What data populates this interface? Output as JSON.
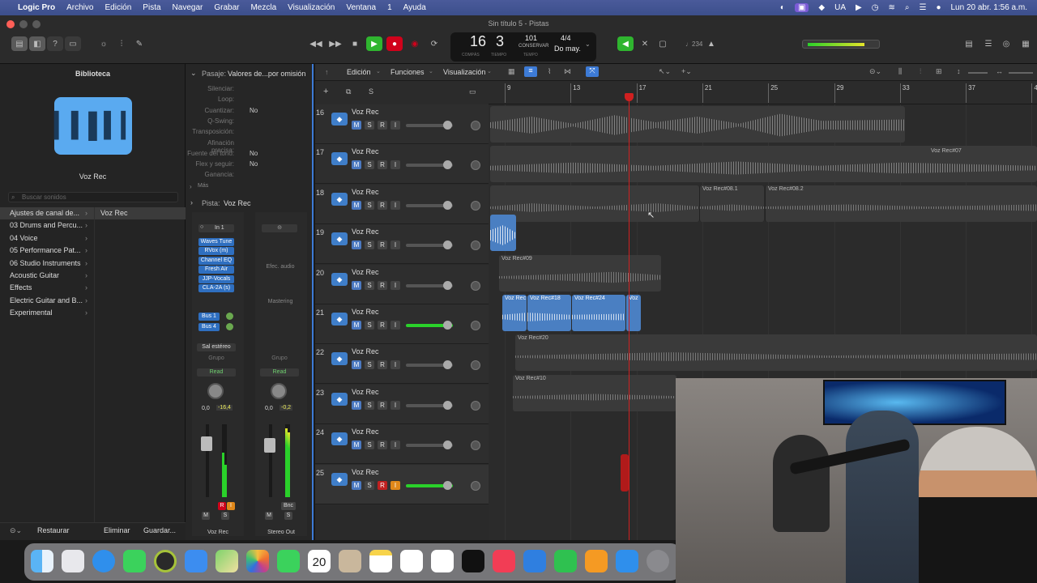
{
  "menubar": {
    "app": "Logic Pro",
    "items": [
      "Archivo",
      "Edición",
      "Pista",
      "Navegar",
      "Grabar",
      "Mezcla",
      "Visualización",
      "Ventana",
      "1",
      "Ayuda"
    ],
    "lang": "UA",
    "clock": "Lun 20 abr.  1:56 a.m."
  },
  "window": {
    "title": "Sin título 5 - Pistas"
  },
  "lcd": {
    "bar": "16",
    "beat": "3",
    "bar_label": "COMPÁS",
    "beat_label": "TIEMPO",
    "tempo": "101",
    "tempo_label": "CONSERVAR",
    "tempo_sub": "TEMPO",
    "signature": "4/4",
    "key": "Do may."
  },
  "toolbar": {
    "count_label": "♩234"
  },
  "library": {
    "title": "Biblioteca",
    "preset_name": "Voz Rec",
    "search_placeholder": "Buscar sonidos",
    "selected_patch": "Voz Rec",
    "categories": [
      "Ajustes de canal de...",
      "03 Drums and Percu...",
      "04 Voice",
      "05 Performance Pat...",
      "06 Studio Instruments",
      "Acoustic Guitar",
      "Effects",
      "Electric Guitar and B...",
      "Experimental"
    ],
    "footer": {
      "restore": "Restaurar",
      "delete": "Eliminar",
      "save": "Guardar..."
    }
  },
  "inspector": {
    "region_header": "Pasaje:",
    "region_value": "Valores de...por omisión",
    "params": [
      {
        "label": "Silenciar:",
        "value": ""
      },
      {
        "label": "Loop:",
        "value": ""
      },
      {
        "label": "Cuantizar:",
        "value": "No"
      },
      {
        "label": "Q-Swing:",
        "value": ""
      },
      {
        "label": "Transposición:",
        "value": ""
      },
      {
        "label": "Afinación precisa:",
        "value": ""
      },
      {
        "label": "Fuente del tono:",
        "value": "No"
      },
      {
        "label": "Flex y seguir:",
        "value": "No"
      },
      {
        "label": "Ganancia:",
        "value": ""
      }
    ],
    "more": "Más",
    "track_header": "Pista:",
    "track_value": "Voz Rec",
    "input": "In 1",
    "plugins": [
      "Waves Tune",
      "RVox (m)",
      "Channel EQ",
      "Fresh Air",
      "JJP-Vocals",
      "CLA-2A (s)"
    ],
    "sends": [
      "Bus 1",
      "Bus 4"
    ],
    "output": "Sal estéreo",
    "group": "Grupo",
    "automation": "Read",
    "pan_left": "0,0",
    "peak_left": "-16,4",
    "pan_right": "0,0",
    "peak_right": "-0,2",
    "audio_fx_label": "Efec. audio",
    "mastering_label": "Mastering",
    "bounce": "Bnc",
    "strip_left_name": "Voz Rec",
    "strip_right_name": "Stereo Out",
    "m": "M",
    "s": "S",
    "r": "R",
    "i": "I"
  },
  "tracks_toolbar": {
    "edit": "Edición",
    "functions": "Funciones",
    "view": "Visualización"
  },
  "ruler": [
    "9",
    "13",
    "17",
    "21",
    "25",
    "29",
    "33",
    "37",
    "41"
  ],
  "playhead_bar": 17,
  "tracks": [
    {
      "num": "16",
      "name": "Voz Rec",
      "m": "M",
      "s": "S",
      "r": "R",
      "i": "I",
      "armed": false
    },
    {
      "num": "17",
      "name": "Voz Rec",
      "m": "M",
      "s": "S",
      "r": "R",
      "i": "I",
      "armed": false
    },
    {
      "num": "18",
      "name": "Voz Rec",
      "m": "M",
      "s": "S",
      "r": "R",
      "i": "I",
      "armed": false
    },
    {
      "num": "19",
      "name": "Voz Rec",
      "m": "M",
      "s": "S",
      "r": "R",
      "i": "I",
      "armed": false
    },
    {
      "num": "20",
      "name": "Voz Rec",
      "m": "M",
      "s": "S",
      "r": "R",
      "i": "I",
      "armed": false
    },
    {
      "num": "21",
      "name": "Voz Rec",
      "m": "M",
      "s": "S",
      "r": "R",
      "i": "I",
      "armed": false
    },
    {
      "num": "22",
      "name": "Voz Rec",
      "m": "M",
      "s": "S",
      "r": "R",
      "i": "I",
      "armed": false
    },
    {
      "num": "23",
      "name": "Voz Rec",
      "m": "M",
      "s": "S",
      "r": "R",
      "i": "I",
      "armed": false
    },
    {
      "num": "24",
      "name": "Voz Rec",
      "m": "M",
      "s": "S",
      "r": "R",
      "i": "I",
      "armed": false
    },
    {
      "num": "25",
      "name": "Voz Rec",
      "m": "M",
      "s": "S",
      "r": "R",
      "i": "I",
      "armed": true
    }
  ],
  "regions": {
    "r07": "Voz Rec#07",
    "r081": "Voz Rec#08.1",
    "r082": "Voz Rec#08.2",
    "r09": "Voz Rec#09",
    "r_a": "Voz Rec",
    "r18": "Voz Rec#18",
    "r24": "Voz Rec#24",
    "r_b": "Voz",
    "r20": "Voz Rec#20",
    "r10": "Voz Rec#10"
  },
  "dock": {
    "calendar_day": "20"
  },
  "colors": {
    "accent": "#3d7bd6",
    "record": "#d0021b",
    "play": "#2fb52f",
    "region_selected": "#4a7fc2"
  }
}
